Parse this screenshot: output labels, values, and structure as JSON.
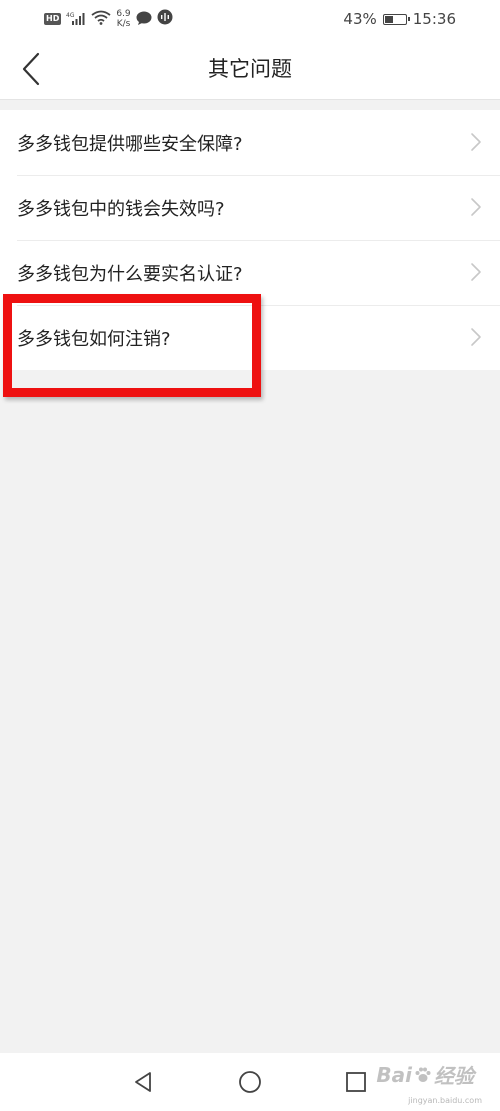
{
  "status_bar": {
    "hd_badge": "HD",
    "network_type": "4G",
    "net_speed_value": "6.9",
    "net_speed_unit": "K/s",
    "battery_percent": "43%",
    "battery_level": 0.43,
    "time": "15:36",
    "icons": [
      "signal-icon",
      "wifi-icon",
      "chat-bubble-icon",
      "voice-icon",
      "battery-icon"
    ]
  },
  "header": {
    "title": "其它问题",
    "back_icon": "chevron-left-icon"
  },
  "faq": {
    "items": [
      {
        "label": "多多钱包提供哪些安全保障?"
      },
      {
        "label": "多多钱包中的钱会失效吗?"
      },
      {
        "label": "多多钱包为什么要实名认证?"
      },
      {
        "label": "多多钱包如何注销?"
      }
    ],
    "highlighted_index": 3,
    "highlight_color": "#ee1111"
  },
  "nav_bar": {
    "buttons": [
      "back-triangle-icon",
      "home-circle-icon",
      "recents-square-icon"
    ]
  },
  "watermark": {
    "logo": "Bai",
    "logo_suffix": "经验",
    "sub": "jingyan.baidu.com"
  },
  "colors": {
    "background": "#f2f2f2",
    "surface": "#ffffff",
    "text": "#222222",
    "chevron": "#c8c8c8"
  }
}
